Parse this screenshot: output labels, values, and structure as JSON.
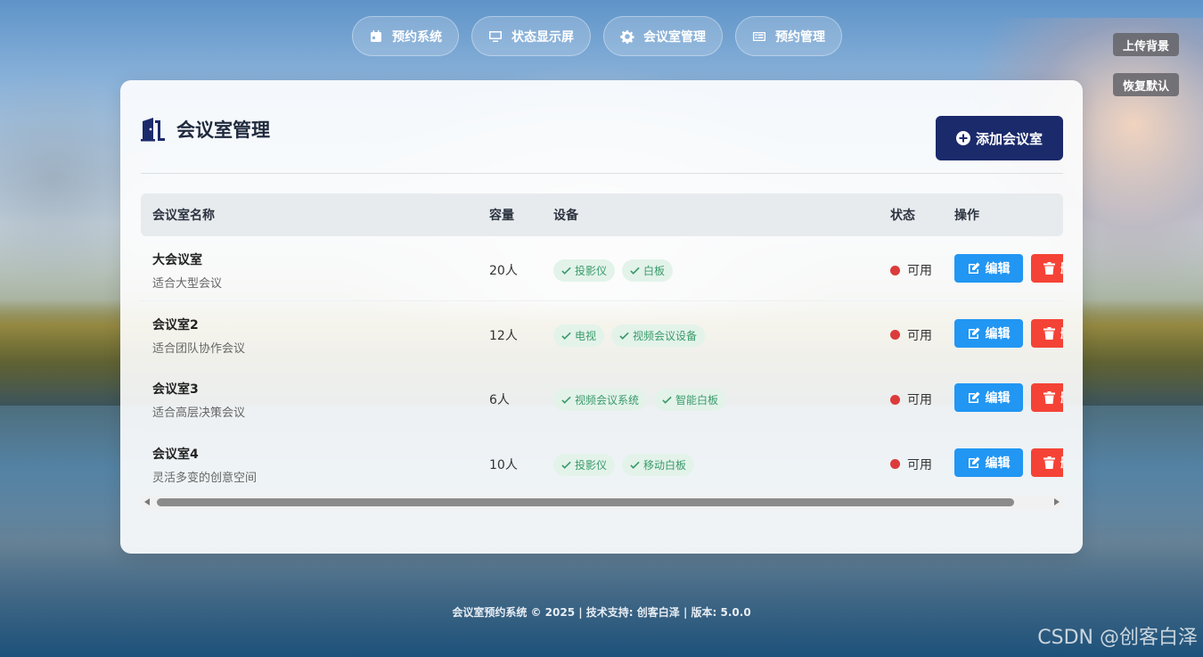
{
  "nav": {
    "items": [
      {
        "label": "预约系统",
        "icon": "calendar-icon"
      },
      {
        "label": "状态显示屏",
        "icon": "monitor-icon"
      },
      {
        "label": "会议室管理",
        "icon": "gear-icon"
      },
      {
        "label": "预约管理",
        "icon": "list-icon"
      }
    ]
  },
  "side": {
    "upload_label": "上传背景",
    "reset_label": "恢复默认"
  },
  "card": {
    "title": "会议室管理",
    "add_label": "添加会议室"
  },
  "table": {
    "headers": {
      "name": "会议室名称",
      "capacity": "容量",
      "equipment": "设备",
      "status": "状态",
      "actions": "操作"
    },
    "edit_label": "编辑",
    "delete_label": "删",
    "rows": [
      {
        "name": "大会议室",
        "desc": "适合大型会议",
        "capacity": "20人",
        "equipment": [
          "投影仪",
          "白板"
        ],
        "status": "可用"
      },
      {
        "name": "会议室2",
        "desc": "适合团队协作会议",
        "capacity": "12人",
        "equipment": [
          "电视",
          "视频会议设备"
        ],
        "status": "可用"
      },
      {
        "name": "会议室3",
        "desc": "适合高层决策会议",
        "capacity": "6人",
        "equipment": [
          "视频会议系统",
          "智能白板"
        ],
        "status": "可用"
      },
      {
        "name": "会议室4",
        "desc": "灵活多变的创意空间",
        "capacity": "10人",
        "equipment": [
          "投影仪",
          "移动白板"
        ],
        "status": "可用"
      }
    ]
  },
  "footer": "会议室预约系统 © 2025 | 技术支持: 创客白泽 | 版本: 5.0.0",
  "watermark": "CSDN @创客白泽",
  "colors": {
    "primary": "#1b2a6b",
    "edit": "#2196f3",
    "delete": "#f44336",
    "status_dot": "#dc3b3b",
    "tag_bg": "#e3f3ea",
    "tag_text": "#3a9a6a"
  }
}
